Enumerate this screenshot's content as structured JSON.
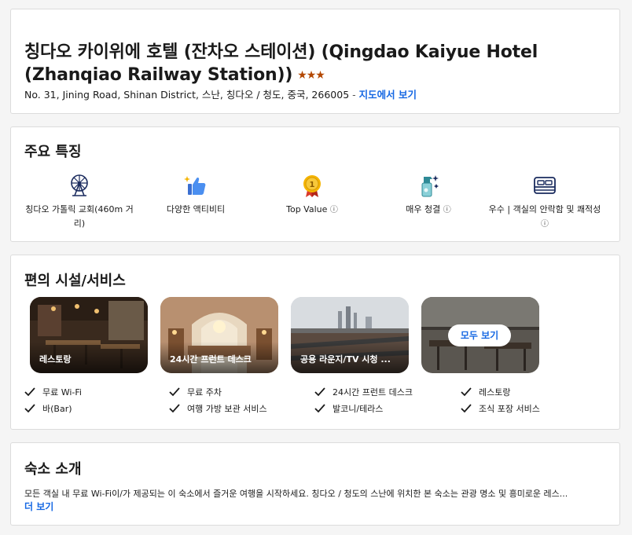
{
  "hotel": {
    "title": "칭다오 카이위에 호텔 (잔차오 스테이션) (Qingdao Kaiyue Hotel (Zhanqiao Railway Station))",
    "stars": "★★★",
    "address": "No. 31, Jining Road, Shinan District, 스난, 칭다오 / 청도, 중국, 266005",
    "address_sep": " - ",
    "map_link": "지도에서 보기"
  },
  "highlights": {
    "title": "주요 특징",
    "items": [
      {
        "label": "칭다오 가톨릭 교회(460m 거리)",
        "icon": "ferris-wheel-icon",
        "info": ""
      },
      {
        "label": "다양한 액티비티",
        "icon": "thumbs-up-icon",
        "info": ""
      },
      {
        "label": "Top Value",
        "icon": "medal-icon",
        "info": "ⓘ"
      },
      {
        "label": "매우 청결",
        "icon": "cleaning-spray-icon",
        "info": "ⓘ"
      },
      {
        "label": "우수 | 객실의 안락함 및 쾌적성",
        "icon": "bed-icon",
        "info": "ⓘ"
      }
    ]
  },
  "amenities": {
    "title": "편의 시설/서비스",
    "photos": [
      {
        "caption": "레스토랑"
      },
      {
        "caption": "24시간 프런트 데스크"
      },
      {
        "caption": "공용 라운지/TV 시청 ..."
      },
      {
        "caption": ""
      }
    ],
    "see_all": "모두 보기",
    "list": [
      "무료 Wi-Fi",
      "무료 주차",
      "24시간 프런트 데스크",
      "레스토랑",
      "바(Bar)",
      "여행 가방 보관 서비스",
      "발코니/테라스",
      "조식 포장 서비스"
    ]
  },
  "about": {
    "title": "숙소 소개",
    "text": "모든 객실 내 무료 Wi-Fi이/가 제공되는 이 숙소에서 즐거운 여행을 시작하세요. 칭다오 / 청도의 스난에 위치한 본 숙소는 관광 명소 및 흥미로운 레스...",
    "more": "더 보기"
  },
  "colors": {
    "link": "#1668e3",
    "star": "#b34700"
  }
}
